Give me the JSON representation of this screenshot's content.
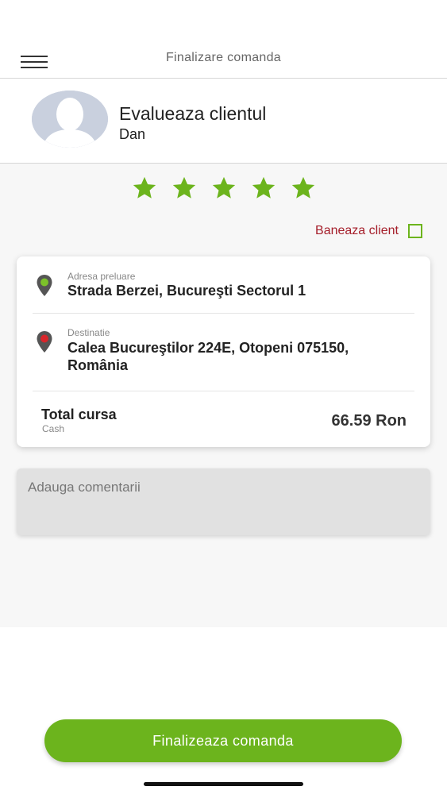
{
  "header": {
    "title": "Finalizare comanda",
    "menu_icon": "hamburger-menu-icon"
  },
  "client": {
    "title": "Evalueaza clientul",
    "name": "Dan",
    "avatar_icon": "user-avatar-placeholder"
  },
  "rating": {
    "value": 5,
    "max": 5,
    "star_color": "#6cb41d"
  },
  "ban": {
    "label": "Baneaza client",
    "checked": false,
    "label_color": "#a51e2a"
  },
  "ride": {
    "pickup_label": "Adresa preluare",
    "pickup_address": "Strada Berzei, Bucureşti Sectorul 1",
    "pickup_icon": "green-location-pin-icon",
    "destination_label": "Destinatie",
    "destination_address_line1": "Calea Bucureştilor 224E, Otopeni 075150,",
    "destination_address_line2": "România",
    "destination_icon": "red-location-pin-icon",
    "total_label": "Total cursa",
    "payment_method": "Cash",
    "total_value": "66.59 Ron"
  },
  "comment": {
    "placeholder": "Adauga comentarii",
    "value": ""
  },
  "actions": {
    "finish_label": "Finalizeaza comanda",
    "accent_color": "#6cb41d"
  }
}
